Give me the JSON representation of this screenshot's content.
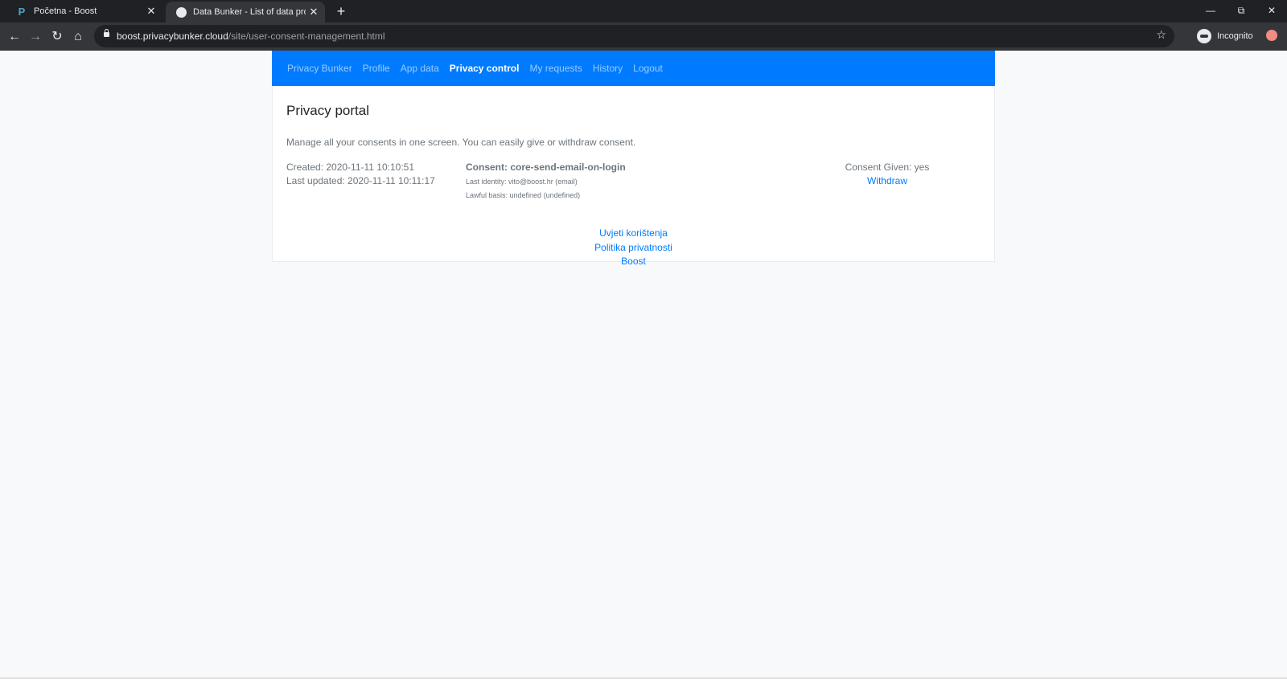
{
  "browser": {
    "tabs": [
      {
        "title": "Početna - Boost",
        "icon": "P"
      },
      {
        "title": "Data Bunker - List of data proces",
        "icon": "globe-icon"
      }
    ],
    "close_glyph": "✕",
    "newtab_glyph": "+",
    "address": {
      "host": "boost.privacybunker.cloud",
      "path": "/site/user-consent-management.html"
    },
    "incognito_label": "Incognito"
  },
  "nav": {
    "brand": "Privacy Bunker",
    "items": [
      "Profile",
      "App data",
      "Privacy control",
      "My requests",
      "History",
      "Logout"
    ],
    "active": "Privacy control"
  },
  "main": {
    "title": "Privacy portal",
    "intro": "Manage all your consents in one screen. You can easily give or withdraw consent.",
    "record": {
      "created": "Created: 2020-11-11 10:10:51",
      "updated": "Last updated: 2020-11-11 10:11:17",
      "consent": "Consent: core-send-email-on-login",
      "identity": "Last identity: vito@boost.hr (email)",
      "lawful": "Lawful basis: undefined (undefined)",
      "given": "Consent Given: yes",
      "action": "Withdraw"
    }
  },
  "footer": {
    "links": [
      "Uvjeti korištenja",
      "Politika privatnosti",
      "Boost"
    ]
  },
  "colors": {
    "navbar": "#007bff",
    "link": "#007bff",
    "page_bg": "#f8f9fa"
  }
}
